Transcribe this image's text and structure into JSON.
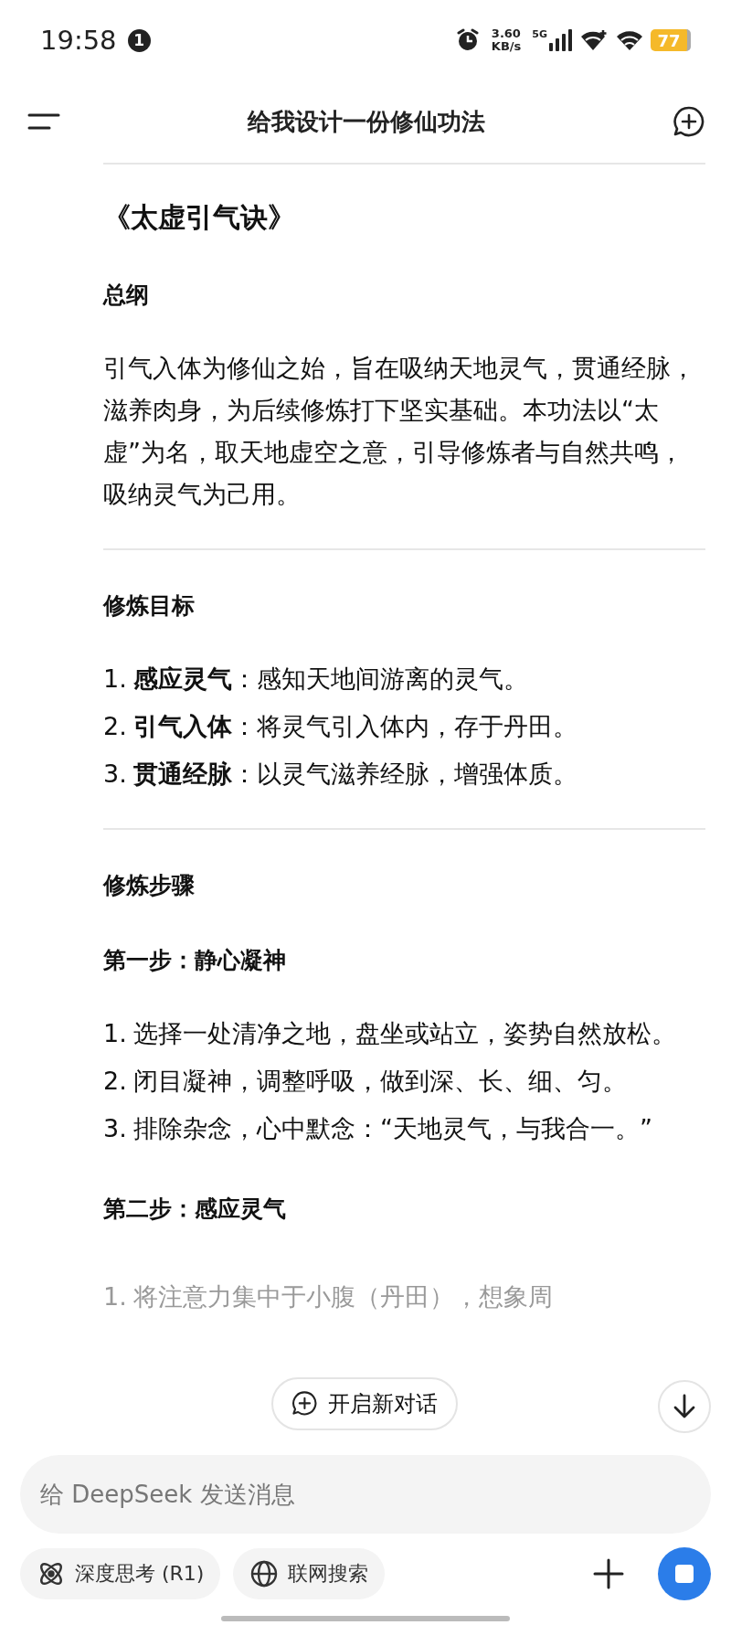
{
  "status_bar": {
    "time": "19:58",
    "notification_count": "1",
    "net_speed": "3.60",
    "net_unit": "KB/s",
    "network": "5G",
    "battery": "77"
  },
  "header": {
    "title": "给我设计一份修仙功法"
  },
  "content": [
    {
      "kind": "title",
      "text": "《太虚引气诀》"
    },
    {
      "kind": "heading",
      "text": "总纲"
    },
    {
      "kind": "paragraph",
      "text": "引气入体为修仙之始，旨在吸纳天地灵气，贯通经脉，滋养肉身，为后续修炼打下坚实基础。本功法以“太虚”为名，取天地虚空之意，引导修炼者与自然共鸣，吸纳灵气为己用。"
    },
    {
      "kind": "divider"
    },
    {
      "kind": "heading",
      "text": "修炼目标"
    },
    {
      "kind": "list",
      "items": [
        {
          "number": "1.",
          "text": "**感应灵气**：感知天地间游离的灵气。"
        },
        {
          "number": "2.",
          "text": "**引气入体**：将灵气引入体内，存于丹田。"
        },
        {
          "number": "3.",
          "text": "**贯通经脉**：以灵气滋养经脉，增强体质。"
        }
      ]
    },
    {
      "kind": "divider"
    },
    {
      "kind": "heading",
      "text": "修炼步骤"
    },
    {
      "kind": "heading",
      "text": "第一步：静心凝神"
    },
    {
      "kind": "list",
      "items": [
        {
          "number": "1.",
          "text": "选择一处清净之地，盘坐或站立，姿势自然放松。"
        },
        {
          "number": "2.",
          "text": "闭目凝神，调整呼吸，做到深、长、细、匀。"
        },
        {
          "number": "3.",
          "text": "排除杂念，心中默念：“天地灵气，与我合一。”"
        }
      ]
    },
    {
      "kind": "heading",
      "text": "第二步：感应灵气"
    },
    {
      "kind": "faded",
      "number": "1.",
      "text": "将注意力集中于小腹（丹田），想象周"
    }
  ],
  "new_chat_button": {
    "label": "开启新对话"
  },
  "composer": {
    "placeholder": "给 DeepSeek 发送消息"
  },
  "chips": [
    {
      "label": "深度思考 (R1)"
    },
    {
      "label": "联网搜索"
    }
  ]
}
